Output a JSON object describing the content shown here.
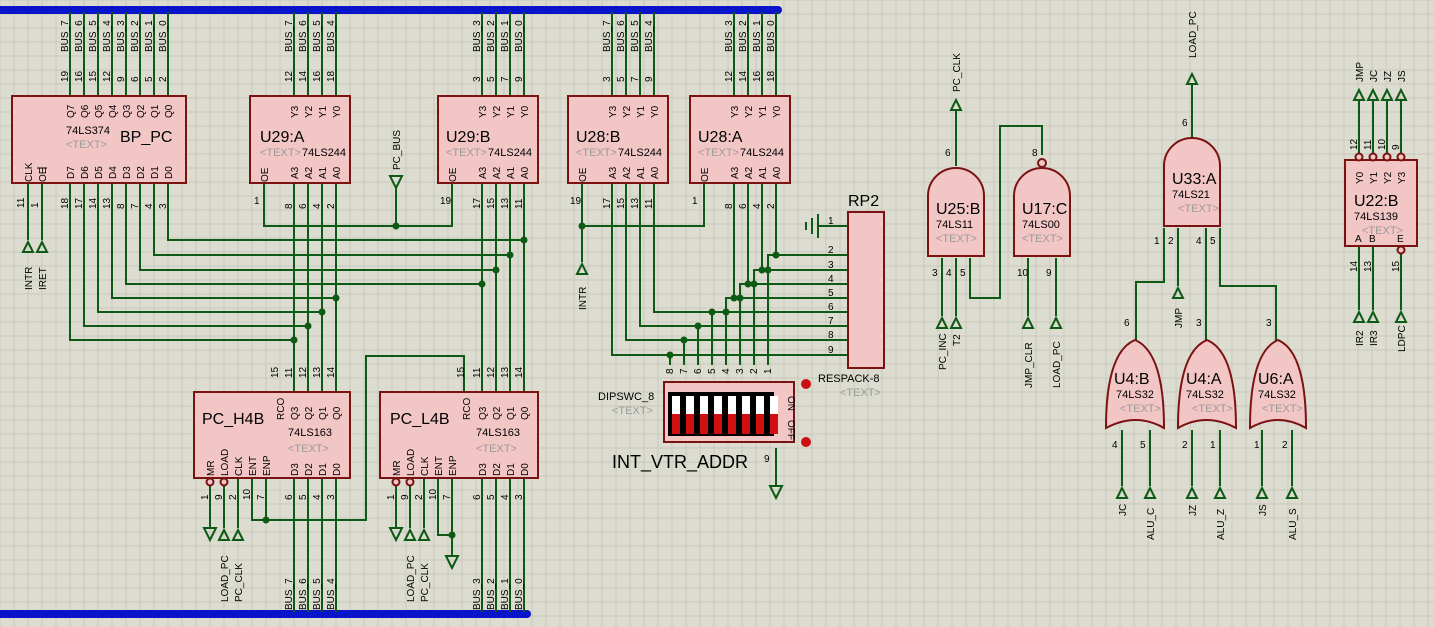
{
  "placeholder": "<TEXT>",
  "top_bus_nets": [
    "BUS_7",
    "BUS_6",
    "BUS_5",
    "BUS_4",
    "BUS_3",
    "BUS_2",
    "BUS_1",
    "BUS_0"
  ],
  "chips": {
    "bp_pc": {
      "name": "BP_PC",
      "part": "74LS374",
      "outputs": [
        "Q7",
        "Q6",
        "Q5",
        "Q4",
        "Q3",
        "Q2",
        "Q1",
        "Q0"
      ],
      "out_pins": [
        "19",
        "16",
        "15",
        "12",
        "9",
        "6",
        "5",
        "2"
      ],
      "inputs": [
        "D7",
        "D6",
        "D5",
        "D4",
        "D3",
        "D2",
        "D1",
        "D0"
      ],
      "in_pins": [
        "18",
        "17",
        "14",
        "13",
        "8",
        "7",
        "4",
        "3"
      ],
      "clk": "CLK",
      "oe": "OE",
      "clk_pin": "11",
      "oe_pin": "1"
    },
    "u29a": {
      "name": "U29:A",
      "part": "74LS244",
      "outputs": [
        "Y3",
        "Y2",
        "Y1",
        "Y0"
      ],
      "out_pins": [
        "12",
        "14",
        "16",
        "18"
      ],
      "inputs": [
        "A3",
        "A2",
        "A1",
        "A0"
      ],
      "in_pins": [
        "8",
        "6",
        "4",
        "2"
      ],
      "oe": "OE",
      "oe_pin": "1"
    },
    "u29b": {
      "name": "U29:B",
      "part": "74LS244",
      "outputs": [
        "Y3",
        "Y2",
        "Y1",
        "Y0"
      ],
      "out_pins": [
        "3",
        "5",
        "7",
        "9"
      ],
      "inputs": [
        "A3",
        "A2",
        "A1",
        "A0"
      ],
      "in_pins": [
        "17",
        "15",
        "13",
        "11"
      ],
      "oe": "OE",
      "oe_pin": "19"
    },
    "u28b": {
      "name": "U28:B",
      "part": "74LS244",
      "outputs": [
        "Y3",
        "Y2",
        "Y1",
        "Y0"
      ],
      "out_pins": [
        "3",
        "5",
        "7",
        "9"
      ],
      "inputs": [
        "A3",
        "A2",
        "A1",
        "A0"
      ],
      "in_pins": [
        "17",
        "15",
        "13",
        "11"
      ],
      "oe": "OE",
      "oe_pin": "19"
    },
    "u28a": {
      "name": "U28:A",
      "part": "74LS244",
      "outputs": [
        "Y3",
        "Y2",
        "Y1",
        "Y0"
      ],
      "out_pins": [
        "12",
        "14",
        "16",
        "18"
      ],
      "inputs": [
        "A3",
        "A2",
        "A1",
        "A0"
      ],
      "in_pins": [
        "8",
        "6",
        "4",
        "2"
      ],
      "oe": "OE",
      "oe_pin": "1"
    },
    "pc_h4b": {
      "name": "PC_H4B",
      "part": "74LS163",
      "top": [
        "RCO",
        "Q3",
        "Q2",
        "Q1",
        "Q0"
      ],
      "top_pins": [
        "15",
        "11",
        "12",
        "13",
        "14"
      ],
      "bottom": [
        "MR",
        "LOAD",
        "CLK",
        "ENT",
        "ENP",
        "D3",
        "D2",
        "D1",
        "D0"
      ],
      "bottom_pins": [
        "1",
        "9",
        "2",
        "10",
        "7",
        "6",
        "5",
        "4",
        "3"
      ]
    },
    "pc_l4b": {
      "name": "PC_L4B",
      "part": "74LS163",
      "top": [
        "RCO",
        "Q3",
        "Q2",
        "Q1",
        "Q0"
      ],
      "top_pins": [
        "15",
        "11",
        "12",
        "13",
        "14"
      ],
      "bottom": [
        "MR",
        "LOAD",
        "CLK",
        "ENT",
        "ENP",
        "D3",
        "D2",
        "D1",
        "D0"
      ],
      "bottom_pins": [
        "1",
        "9",
        "2",
        "10",
        "7",
        "6",
        "5",
        "4",
        "3"
      ]
    },
    "u22b": {
      "name": "U22:B",
      "part": "74LS139",
      "outputs": [
        "Y0",
        "Y1",
        "Y2",
        "Y3"
      ],
      "out_pins": [
        "12",
        "11",
        "10",
        "9"
      ],
      "inputs": [
        "A",
        "B",
        "E"
      ],
      "in_pins": [
        "14",
        "13",
        "15"
      ]
    }
  },
  "gates": {
    "u25b": {
      "name": "U25:B",
      "part": "74LS11",
      "in_pins": [
        "3",
        "4",
        "5"
      ],
      "out_pin": "6"
    },
    "u17c": {
      "name": "U17:C",
      "part": "74LS00",
      "in_pins": [
        "10",
        "9"
      ],
      "out_pin": "8"
    },
    "u33a": {
      "name": "U33:A",
      "part": "74LS21",
      "in_pins": [
        "1",
        "2",
        "4",
        "5"
      ],
      "out_pin": "6"
    },
    "u4b": {
      "name": "U4:B",
      "part": "74LS32",
      "in_pins": [
        "4",
        "5"
      ],
      "out_pin": "6"
    },
    "u4a": {
      "name": "U4:A",
      "part": "74LS32",
      "in_pins": [
        "2",
        "1"
      ],
      "out_pin": "3"
    },
    "u6a": {
      "name": "U6:A",
      "part": "74LS32",
      "in_pins": [
        "1",
        "2"
      ],
      "out_pin": "3"
    }
  },
  "rp2": {
    "name": "RP2",
    "part": "RESPACK-8",
    "pins": [
      "1",
      "2",
      "3",
      "4",
      "5",
      "6",
      "7",
      "8",
      "9"
    ]
  },
  "dipsw": {
    "part": "DIPSWC_8",
    "label": "INT_VTR_ADDR",
    "on_text": "ON",
    "off_text": "OFF",
    "pins": [
      "8",
      "7",
      "6",
      "5",
      "4",
      "3",
      "2",
      "1"
    ],
    "gnd_pin": "9"
  },
  "nets": {
    "intr": "INTR",
    "iret": "IRET",
    "pc_bus": "PC_BUS",
    "pc_clk": "PC_CLK",
    "load_pc": "LOAD_PC",
    "pc_inc": "PC_INC",
    "t2": "T2",
    "jmp_clr": "JMP_CLR",
    "jmp": "JMP",
    "jc": "JC",
    "jz": "JZ",
    "js": "JS",
    "alu_c": "ALU_C",
    "alu_z": "ALU_Z",
    "alu_s": "ALU_S",
    "ir2": "IR2",
    "ir3": "IR3",
    "ldpc": "LDPC",
    "u22_outs": [
      "JMP",
      "JC",
      "JZ",
      "JS"
    ],
    "bottom_left": [
      "BUS_7",
      "BUS_6",
      "BUS_5",
      "BUS_4"
    ],
    "bottom_right": [
      "BUS_3",
      "BUS_2",
      "BUS_1",
      "BUS_0"
    ]
  },
  "colors": {
    "wire": "#0c5a14",
    "bus": "#0a14c8",
    "chip_fill": "#f3c6c6",
    "chip_edge": "#7a1212",
    "background": "#dcdcd0"
  }
}
